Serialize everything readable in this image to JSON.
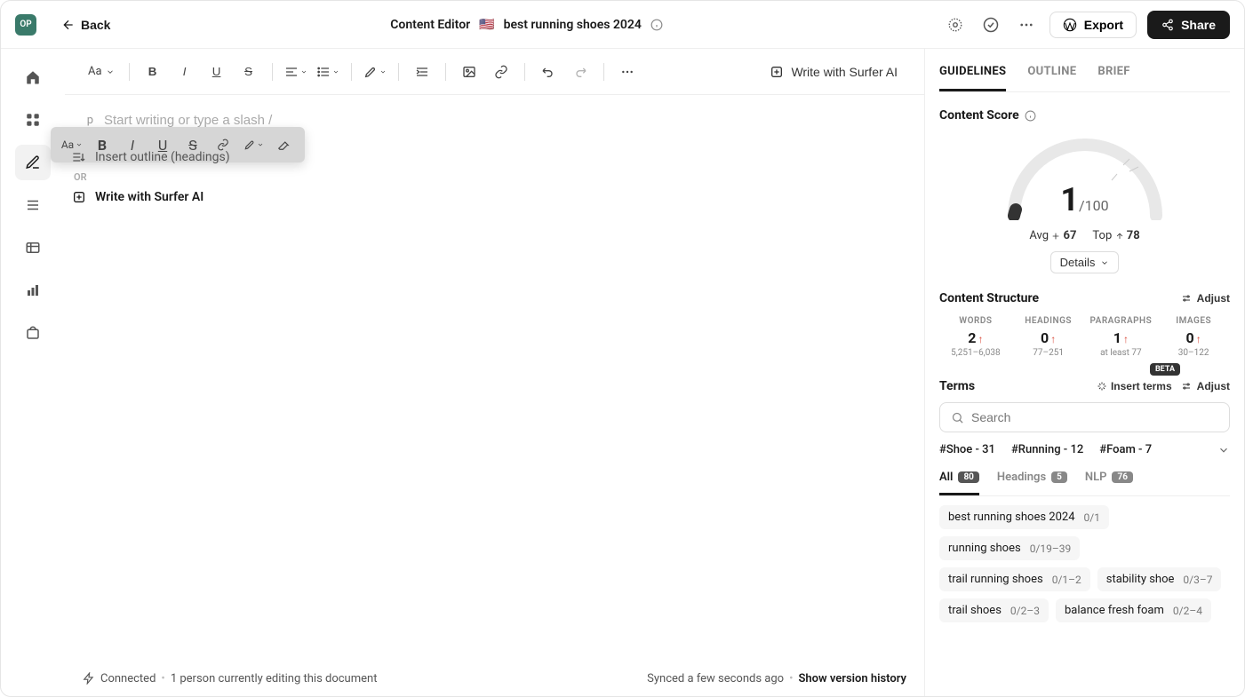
{
  "avatar_initials": "OP",
  "back_label": "Back",
  "header": {
    "section": "Content Editor",
    "flag": "🇺🇸",
    "title": "best running shoes 2024"
  },
  "export_label": "Export",
  "share_label": "Share",
  "ai_button": "Write with Surfer AI",
  "editor": {
    "p_tag": "p",
    "placeholder": "Start writing or type a slash /",
    "hint_outline": "Insert outline (headings)",
    "hint_or": "OR",
    "hint_ai": "Write with Surfer AI"
  },
  "status": {
    "connected": "Connected",
    "editing": "1 person currently editing this document",
    "synced": "Synced a few seconds ago",
    "version_history": "Show version history"
  },
  "rtabs": {
    "guidelines": "GUIDELINES",
    "outline": "OUTLINE",
    "brief": "BRIEF"
  },
  "score": {
    "title": "Content Score",
    "value": "1",
    "max": "/100",
    "avg_label": "Avg",
    "avg_value": "67",
    "top_label": "Top",
    "top_value": "78",
    "details": "Details"
  },
  "structure": {
    "title": "Content Structure",
    "adjust": "Adjust",
    "items": [
      {
        "label": "WORDS",
        "value": "2",
        "range": "5,251–6,038"
      },
      {
        "label": "HEADINGS",
        "value": "0",
        "range": "77–251"
      },
      {
        "label": "PARAGRAPHS",
        "value": "1",
        "range": "at least 77"
      },
      {
        "label": "IMAGES",
        "value": "0",
        "range": "30–122"
      }
    ]
  },
  "terms": {
    "title": "Terms",
    "insert": "Insert terms",
    "beta": "BETA",
    "adjust": "Adjust",
    "search_placeholder": "Search",
    "hashtags": [
      {
        "text": "#Shoe - 31"
      },
      {
        "text": "#Running - 12"
      },
      {
        "text": "#Foam - 7"
      }
    ],
    "tabs": {
      "all": "All",
      "all_count": "80",
      "headings": "Headings",
      "headings_count": "5",
      "nlp": "NLP",
      "nlp_count": "76"
    },
    "list": [
      {
        "term": "best running shoes 2024",
        "count": "0/1"
      },
      {
        "term": "running shoes",
        "count": "0/19–39"
      },
      {
        "term": "trail running shoes",
        "count": "0/1–2"
      },
      {
        "term": "stability shoe",
        "count": "0/3–7"
      },
      {
        "term": "trail shoes",
        "count": "0/2–3"
      },
      {
        "term": "balance fresh foam",
        "count": "0/2–4"
      }
    ]
  }
}
